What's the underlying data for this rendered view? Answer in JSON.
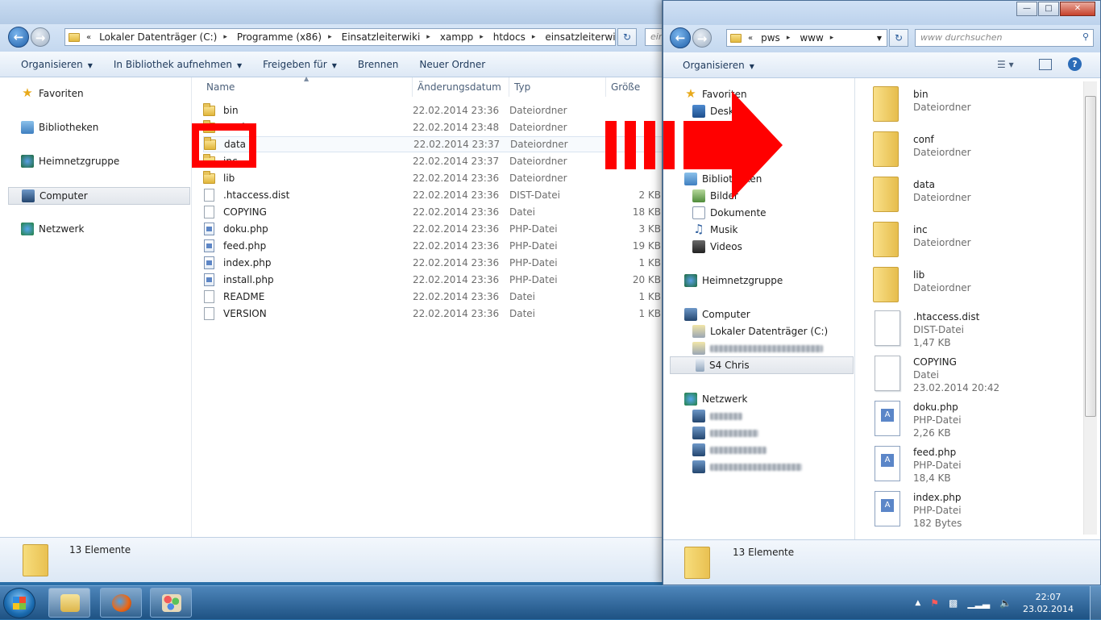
{
  "left_window": {
    "breadcrumbs": [
      "Lokaler Datenträger (C:)",
      "Programme (x86)",
      "Einsatzleiterwiki",
      "xampp",
      "htdocs",
      "einsatzleiterwiki"
    ],
    "search_placeholder": "ein",
    "toolbar": [
      "Organisieren",
      "In Bibliothek aufnehmen",
      "Freigeben für",
      "Brennen",
      "Neuer Ordner"
    ],
    "nav": [
      "Favoriten",
      "Bibliotheken",
      "Heimnetzgruppe",
      "Computer",
      "Netzwerk"
    ],
    "columns": [
      "Name",
      "Änderungsdatum",
      "Typ",
      "Größe"
    ],
    "files": [
      {
        "name": "bin",
        "date": "22.02.2014 23:36",
        "type": "Dateiordner",
        "size": "",
        "kind": "folder"
      },
      {
        "name": "conf",
        "date": "22.02.2014 23:48",
        "type": "Dateiordner",
        "size": "",
        "kind": "folder"
      },
      {
        "name": "data",
        "date": "22.02.2014 23:37",
        "type": "Dateiordner",
        "size": "",
        "kind": "folder"
      },
      {
        "name": "inc",
        "date": "22.02.2014 23:37",
        "type": "Dateiordner",
        "size": "",
        "kind": "folder"
      },
      {
        "name": "lib",
        "date": "22.02.2014 23:36",
        "type": "Dateiordner",
        "size": "",
        "kind": "folder"
      },
      {
        "name": ".htaccess.dist",
        "date": "22.02.2014 23:36",
        "type": "DIST-Datei",
        "size": "2 KB",
        "kind": "file"
      },
      {
        "name": "COPYING",
        "date": "22.02.2014 23:36",
        "type": "Datei",
        "size": "18 KB",
        "kind": "file"
      },
      {
        "name": "doku.php",
        "date": "22.02.2014 23:36",
        "type": "PHP-Datei",
        "size": "3 KB",
        "kind": "php"
      },
      {
        "name": "feed.php",
        "date": "22.02.2014 23:36",
        "type": "PHP-Datei",
        "size": "19 KB",
        "kind": "php"
      },
      {
        "name": "index.php",
        "date": "22.02.2014 23:36",
        "type": "PHP-Datei",
        "size": "1 KB",
        "kind": "php"
      },
      {
        "name": "install.php",
        "date": "22.02.2014 23:36",
        "type": "PHP-Datei",
        "size": "20 KB",
        "kind": "php"
      },
      {
        "name": "README",
        "date": "22.02.2014 23:36",
        "type": "Datei",
        "size": "1 KB",
        "kind": "file"
      },
      {
        "name": "VERSION",
        "date": "22.02.2014 23:36",
        "type": "Datei",
        "size": "1 KB",
        "kind": "file"
      }
    ],
    "status": "13 Elemente"
  },
  "right_window": {
    "breadcrumbs": [
      "pws",
      "www"
    ],
    "search_placeholder": "www durchsuchen",
    "toolbar": [
      "Organisieren"
    ],
    "nav": {
      "favorites": "Favoriten",
      "desktop": "Desktop",
      "libraries": "Bibliotheken",
      "pictures": "Bilder",
      "documents": "Dokumente",
      "music": "Musik",
      "videos": "Videos",
      "homegroup": "Heimnetzgruppe",
      "computer": "Computer",
      "local_disk": "Lokaler Datenträger (C:)",
      "phone": "S4 Chris",
      "network": "Netzwerk"
    },
    "tiles": [
      {
        "name": "bin",
        "line2": "Dateiordner",
        "line3": "",
        "kind": "folder"
      },
      {
        "name": "conf",
        "line2": "Dateiordner",
        "line3": "",
        "kind": "folder"
      },
      {
        "name": "data",
        "line2": "Dateiordner",
        "line3": "",
        "kind": "folder"
      },
      {
        "name": "inc",
        "line2": "Dateiordner",
        "line3": "",
        "kind": "folder"
      },
      {
        "name": "lib",
        "line2": "Dateiordner",
        "line3": "",
        "kind": "folder"
      },
      {
        "name": ".htaccess.dist",
        "line2": "DIST-Datei",
        "line3": "1,47 KB",
        "kind": "file"
      },
      {
        "name": "COPYING",
        "line2": "Datei",
        "line3": "23.02.2014 20:42",
        "kind": "file"
      },
      {
        "name": "doku.php",
        "line2": "PHP-Datei",
        "line3": "2,26 KB",
        "kind": "php"
      },
      {
        "name": "feed.php",
        "line2": "PHP-Datei",
        "line3": "18,4 KB",
        "kind": "php"
      },
      {
        "name": "index.php",
        "line2": "PHP-Datei",
        "line3": "182 Bytes",
        "kind": "php"
      }
    ],
    "status": "13 Elemente"
  },
  "taskbar": {
    "time": "22:07",
    "date": "23.02.2014"
  },
  "colors": {
    "highlight": "#ff0000",
    "arrow": "#ff0000"
  }
}
